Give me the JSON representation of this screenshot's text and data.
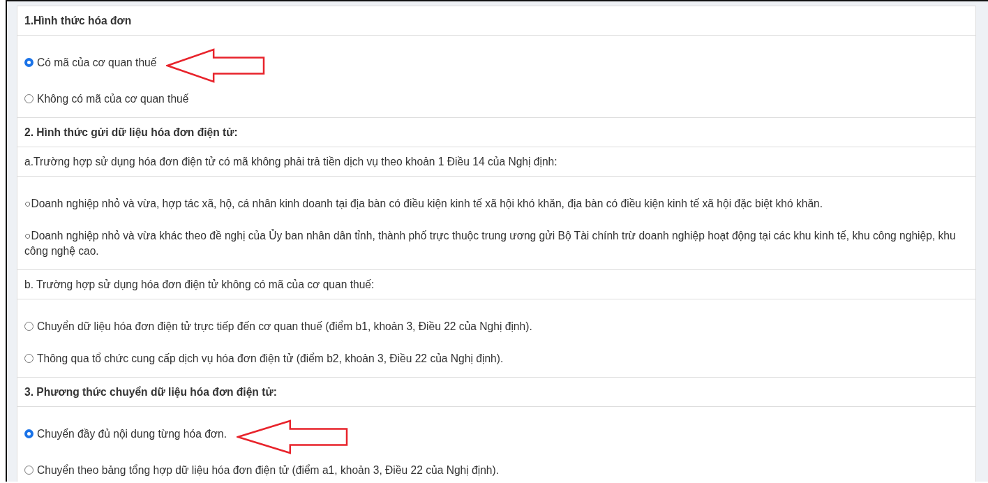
{
  "rows": [
    {
      "kind": "heading",
      "text": "1.Hình thức hóa đơn"
    },
    {
      "kind": "options",
      "options": [
        {
          "kind": "radio",
          "label": "Có mã của cơ quan thuế",
          "selected": true,
          "arrow": true
        },
        {
          "kind": "radio",
          "label": "Không có mã của cơ quan thuế",
          "selected": false,
          "arrow": false
        }
      ]
    },
    {
      "kind": "heading",
      "text": "2. Hình thức gửi dữ liệu hóa đơn điện tử:"
    },
    {
      "kind": "subheading",
      "text": "a.Trường hợp sử dụng hóa đơn điện tử có mã không phải trả tiền dịch vụ theo khoản 1 Điều 14 của Nghị định:"
    },
    {
      "kind": "options",
      "options": [
        {
          "kind": "glyph",
          "label": "○Doanh nghiệp nhỏ và vừa, hợp tác xã, hộ, cá nhân kinh doanh tại địa bàn có điều kiện kinh tế xã hội khó khăn, địa bàn có điều kiện kinh tế xã hội đặc biệt khó khăn.",
          "arrow": false
        },
        {
          "kind": "glyph",
          "label": "○Doanh nghiệp nhỏ và vừa khác theo đề nghị của Ủy ban nhân dân tỉnh, thành phố trực thuộc trung ương gửi Bộ Tài chính trừ doanh nghiệp hoạt động tại các khu kinh tế, khu công nghiệp, khu công nghệ cao.",
          "arrow": false
        }
      ]
    },
    {
      "kind": "subheading",
      "text": "b. Trường hợp sử dụng hóa đơn điện tử không có mã của cơ quan thuế:"
    },
    {
      "kind": "options",
      "options": [
        {
          "kind": "radio",
          "label": "Chuyển dữ liệu hóa đơn điện tử trực tiếp đến cơ quan thuế (điểm b1, khoản 3, Điều 22 của Nghị định).",
          "selected": false,
          "arrow": false
        },
        {
          "kind": "radio",
          "label": "Thông qua tổ chức cung cấp dịch vụ hóa đơn điện tử (điểm b2, khoản 3, Điều 22 của Nghị định).",
          "selected": false,
          "arrow": false
        }
      ]
    },
    {
      "kind": "heading",
      "text": "3. Phương thức chuyển dữ liệu hóa đơn điện tử:"
    },
    {
      "kind": "options",
      "options": [
        {
          "kind": "radio",
          "label": "Chuyển đầy đủ nội dung từng hóa đơn.",
          "selected": true,
          "arrow": true
        },
        {
          "kind": "radio",
          "label": "Chuyển theo bảng tổng hợp dữ liệu hóa đơn điện tử (điểm a1, khoản 3, Điều 22 của Nghị định).",
          "selected": false,
          "arrow": false
        }
      ]
    }
  ]
}
